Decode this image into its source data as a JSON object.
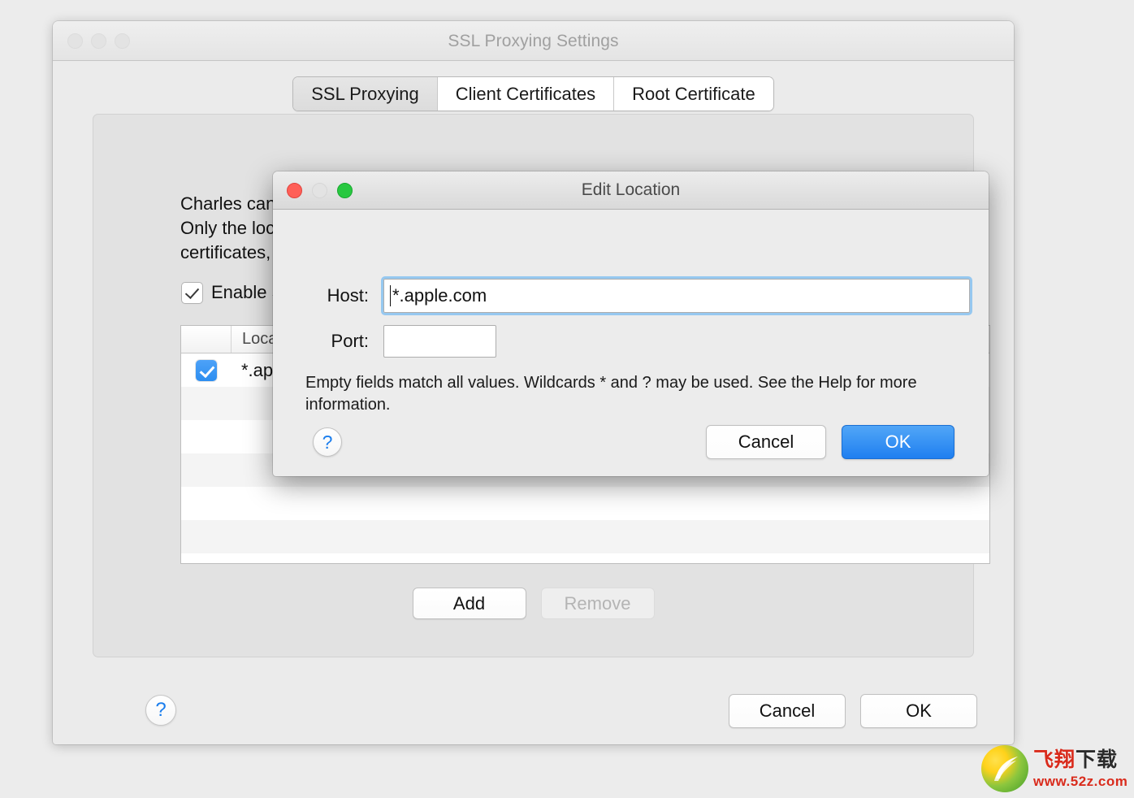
{
  "main_window": {
    "title": "SSL Proxying Settings",
    "traffic_lights": [
      "close-inactive",
      "minimize-inactive",
      "zoom-inactive"
    ],
    "tabs": [
      {
        "label": "SSL Proxying",
        "selected": true
      },
      {
        "label": "Client Certificates",
        "selected": false
      },
      {
        "label": "Root Certificate",
        "selected": false
      }
    ],
    "panel": {
      "description_lines": [
        "Charles can sh",
        "Only the locati",
        "certificates, ple"
      ],
      "enable_checkbox": {
        "label": "Enable SSL",
        "checked": true
      },
      "table": {
        "columns": [
          "",
          "Location"
        ],
        "rows": [
          {
            "checked": true,
            "location": "*.apple.c"
          },
          {
            "checked": false,
            "location": ""
          },
          {
            "checked": false,
            "location": ""
          },
          {
            "checked": false,
            "location": ""
          },
          {
            "checked": false,
            "location": ""
          },
          {
            "checked": false,
            "location": ""
          },
          {
            "checked": false,
            "location": ""
          }
        ]
      },
      "add_label": "Add",
      "remove_label": "Remove",
      "remove_disabled": true
    },
    "footer": {
      "help_label": "?",
      "cancel_label": "Cancel",
      "ok_label": "OK"
    }
  },
  "dialog": {
    "title": "Edit Location",
    "traffic_lights": [
      "close-active",
      "minimize-active",
      "zoom-active"
    ],
    "host_label": "Host:",
    "host_value": "*.apple.com",
    "host_placeholder": "",
    "port_label": "Port:",
    "port_value": "",
    "port_placeholder": "",
    "hint": "Empty fields match all values. Wildcards * and ? may be used. See the Help for more information.",
    "help_label": "?",
    "cancel_label": "Cancel",
    "ok_label": "OK"
  },
  "watermark": {
    "cn_text_1": "飞翔",
    "cn_text_2": "下载",
    "url": "www.52z.com"
  },
  "colors": {
    "accent_blue": "#2d8ef0",
    "window_bg": "#ebebeb",
    "panel_bg": "#e2e2e2",
    "ok_blue": "#1f7ff0",
    "help_blue": "#1a7ded",
    "watermark_red": "#d92b1c"
  }
}
